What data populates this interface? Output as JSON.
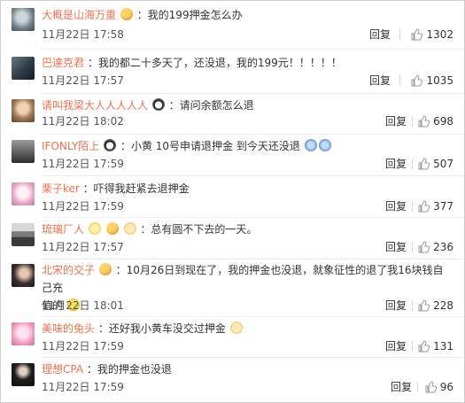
{
  "comments": [
    {
      "username": "大概是山海万重",
      "text": "：我的199押金怎么办",
      "emojis": [
        "angry-face-emoji"
      ],
      "time": "11月22日 17:58",
      "reply_label": "回复",
      "likes": "1302",
      "avatar_color": "#6d7f8a"
    },
    {
      "username": "巴達克君",
      "text": "：我的都二十多天了，还没退，我的199元！！！！！",
      "emojis": [],
      "time": "11月22日 17:57",
      "reply_label": "回复",
      "likes": "1035",
      "avatar_color": "#2f3b44"
    },
    {
      "username": "请叫我梁大人人人人人",
      "text": "：请问余额怎么退",
      "emojis": [
        "panda-face-emoji"
      ],
      "time": "11月22日 18:02",
      "reply_label": "回复",
      "likes": "698",
      "avatar_color": "#a07a5a"
    },
    {
      "username": "IFONLY陌上",
      "text": "：小黄 10号申请退押金  到今天还没退",
      "emojis": [
        "panda-face-emoji",
        "crying-face-emoji",
        "crying-face-emoji"
      ],
      "time": "11月22日 17:59",
      "reply_label": "回复",
      "likes": "507",
      "avatar_color": "#777777"
    },
    {
      "username": "栗子ker",
      "text": "：吓得我赶紧去退押金",
      "emojis": [],
      "time": "11月22日 17:59",
      "reply_label": "回复",
      "likes": "377",
      "avatar_color": "#e6a9c8"
    },
    {
      "username": "琉璃厂人",
      "text": "：总有圆不下去的一天。",
      "emojis": [
        "victory-emoji",
        "angry-face-emoji",
        "cute-face-emoji"
      ],
      "time": "11月22日 17:57",
      "reply_label": "回复",
      "likes": "236",
      "avatar_color": "#4b4b4b"
    },
    {
      "username": "北宋的交子",
      "text_line1": "：10月26日到现在了，我的押金也没退，就象征性的退了我16块钱自己充",
      "text_line2": "值的",
      "emojis": [
        "angry-face-emoji",
        "duck-emoji"
      ],
      "time": "11月22日 18:01",
      "reply_label": "回复",
      "likes": "228",
      "avatar_color": "#3a2f2f"
    },
    {
      "username": "美味的兔头",
      "text": "：还好我小黄车没交过押金",
      "emojis": [
        "cute-face-emoji"
      ],
      "time": "11月22日 17:59",
      "reply_label": "回复",
      "likes": "131",
      "avatar_color": "#f0a0c0"
    },
    {
      "username": "理想CPA",
      "text": "：我的押金也没退",
      "emojis": [],
      "time": "11月22日 17:59",
      "reply_label": "回复",
      "likes": "96",
      "avatar_color": "#1f1f1f"
    }
  ],
  "colors": {
    "username": "#eb7350",
    "text": "#333333",
    "meta": "#555555"
  }
}
